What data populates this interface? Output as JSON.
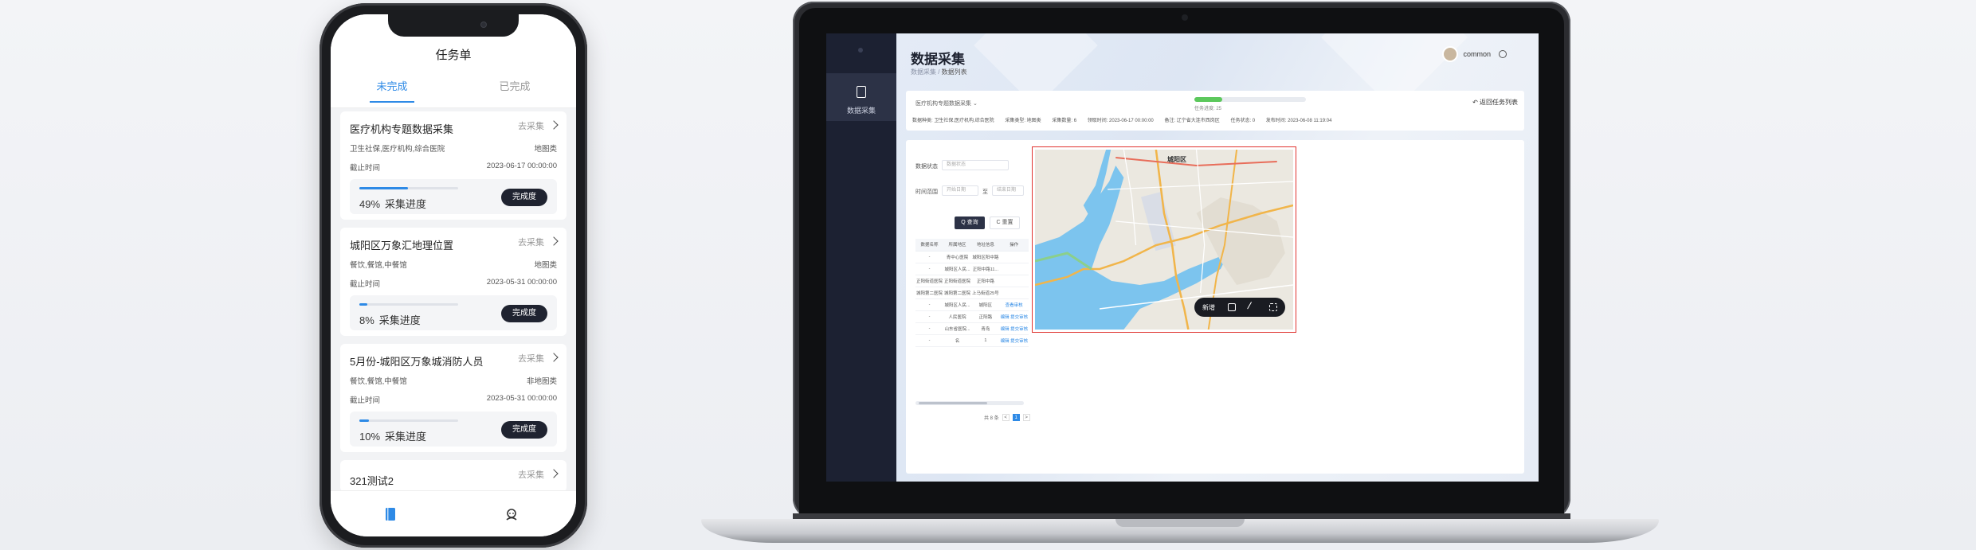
{
  "phone": {
    "title": "任务单",
    "tabs": [
      {
        "label": "未完成",
        "active": true
      },
      {
        "label": "已完成",
        "active": false
      }
    ],
    "tasks": [
      {
        "title": "医疗机构专题数据采集",
        "action": "去采集",
        "category": "卫生社保,医疗机构,综合医院",
        "type": "地图类",
        "deadline_label": "截止时间",
        "deadline": "2023-06-17 00:00:00",
        "percent_text": "49%",
        "progress": 0.49,
        "progress_label": "采集进度",
        "done_label": "完成度"
      },
      {
        "title": "城阳区万象汇地理位置",
        "action": "去采集",
        "category": "餐饮,餐馆,中餐馆",
        "type": "地图类",
        "deadline_label": "截止时间",
        "deadline": "2023-05-31 00:00:00",
        "percent_text": "8%",
        "progress": 0.08,
        "progress_label": "采集进度",
        "done_label": "完成度"
      },
      {
        "title": "5月份-城阳区万象城消防人员",
        "action": "去采集",
        "category": "餐饮,餐馆,中餐馆",
        "type": "非地图类",
        "deadline_label": "截止时间",
        "deadline": "2023-05-31 00:00:00",
        "percent_text": "10%",
        "progress": 0.1,
        "progress_label": "采集进度",
        "done_label": "完成度"
      },
      {
        "title": "321测试2",
        "action": "去采集"
      }
    ],
    "bottom_nav": [
      {
        "icon": "task-book-icon",
        "active": true
      },
      {
        "icon": "profile-icon",
        "active": false
      }
    ]
  },
  "laptop": {
    "sidebar": {
      "item_label": "数据采集"
    },
    "page_title": "数据采集",
    "breadcrumb": {
      "parent": "数据采集",
      "sep": " / ",
      "current": "数据列表"
    },
    "user": {
      "name": "common"
    },
    "info": {
      "select_label": "医疗机构专题数据采集",
      "progress": 0.25,
      "progress_label": "任务进度: 25",
      "back_label": "返回任务列表",
      "meta": [
        "数据种类: 卫生社保,医疗机构,综合医院",
        "采集类型: 地图类",
        "采集数量: 6",
        "领取时间: 2023-06-17 00:00:00",
        "备注: 辽宁省大连市西岗区",
        "任务状态: 0",
        "发布时间: 2023-06-08 11:19:04"
      ]
    },
    "filters": {
      "status_label": "数据状态",
      "status_placeholder": "数据状态",
      "time_label": "时间范围",
      "start_placeholder": "开始日期",
      "range_sep": "至",
      "end_placeholder": "结束日期",
      "query_label": "Q 查询",
      "reset_label": "C 重置"
    },
    "table": {
      "headers": [
        "数据名称",
        "所属地区",
        "地址信息",
        "操作"
      ],
      "rows": [
        [
          "-",
          "青中心医院",
          "城阳区阳中路",
          ""
        ],
        [
          "-",
          "城阳区人民...",
          "正阳中路11...",
          ""
        ],
        [
          "正阳街道医院",
          "正阳街道医院",
          "正阳中路",
          ""
        ],
        [
          "城阳第二医院",
          "城阳第二医院",
          "上马街道25号",
          ""
        ],
        [
          "-",
          "城阳区人民...",
          "城阳区",
          "查看审核"
        ],
        [
          "-",
          "人民医院",
          "正阳路",
          "编辑 提交审核 删除"
        ],
        [
          "-",
          "山东省医院...",
          "青岛",
          "编辑 提交审核 删除"
        ],
        [
          "-",
          "名",
          "1",
          "编辑 提交审核 删除"
        ]
      ]
    },
    "pager": {
      "total": "共 8 条",
      "pages": [
        "<",
        "1",
        ">"
      ]
    },
    "map": {
      "district_label": "城阳区",
      "toolbar": {
        "add_label": "新增",
        "tools": [
          "select-box-icon",
          "draw-line-icon",
          "clear-icon"
        ]
      }
    }
  }
}
